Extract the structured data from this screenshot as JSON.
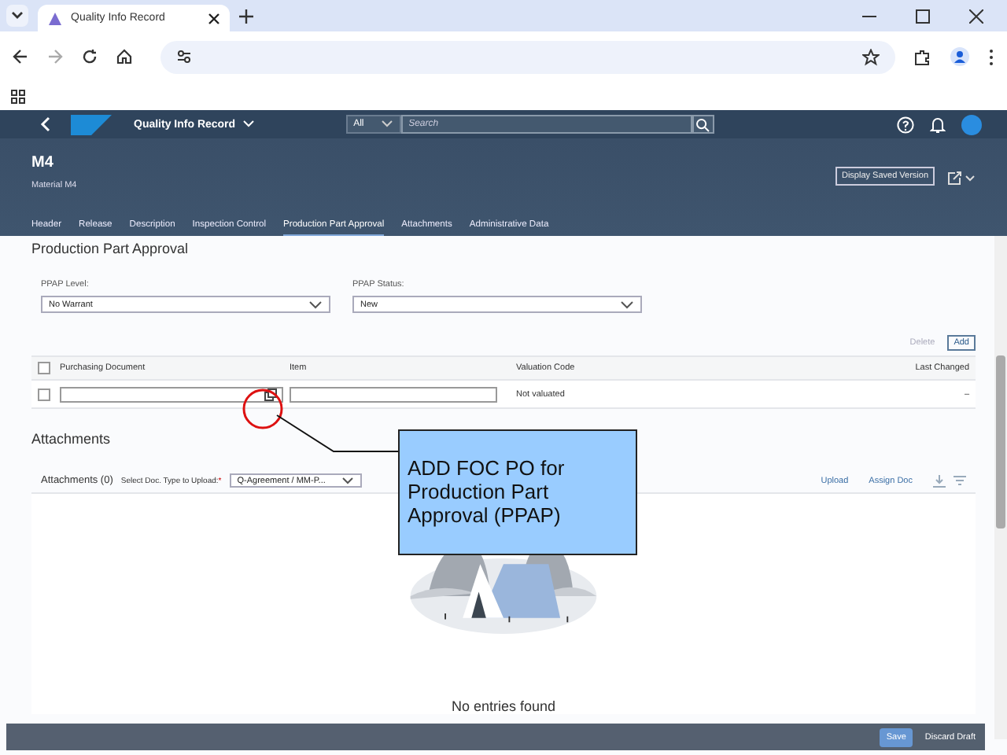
{
  "browser": {
    "tab_title": "Quality Info Record"
  },
  "shell": {
    "title": "Quality Info Record",
    "search_scope": "All",
    "search_placeholder": "Search"
  },
  "object_header": {
    "title": "M4",
    "subtitle": "Material M4",
    "display_saved_version": "Display Saved Version"
  },
  "section_tabs": [
    {
      "label": "Header",
      "selected": false
    },
    {
      "label": "Release",
      "selected": false
    },
    {
      "label": "Description",
      "selected": false
    },
    {
      "label": "Inspection Control",
      "selected": false
    },
    {
      "label": "Production Part Approval",
      "selected": true
    },
    {
      "label": "Attachments",
      "selected": false
    },
    {
      "label": "Administrative Data",
      "selected": false
    }
  ],
  "ppap": {
    "title": "Production Part Approval",
    "fields": [
      {
        "label": "PPAP Level:",
        "value": "No Warrant"
      },
      {
        "label": "PPAP Status:",
        "value": "New"
      }
    ],
    "delete_button": "Delete",
    "add_button": "Add",
    "select_all_checked": false,
    "columns": [
      "Purchasing Document",
      "Item",
      "Valuation Code",
      "Last Changed"
    ],
    "rows": [
      {
        "checked": false,
        "valuation_code": "Not valuated",
        "last_changed": "–"
      }
    ]
  },
  "attachments": {
    "title": "Attachments",
    "count_label": "Attachments (0)",
    "doc_type_label": "Select Doc. Type to Upload:",
    "required_mark": "*",
    "doc_type_value": "Q-Agreement / MM-P...",
    "upload": "Upload",
    "assign_doc": "Assign Doc",
    "empty_text": "No entries found"
  },
  "footer": {
    "save": "Save",
    "discard_draft": "Discard Draft"
  },
  "callout": {
    "text": "ADD FOC PO for Production Part Approval (PPAP)"
  }
}
